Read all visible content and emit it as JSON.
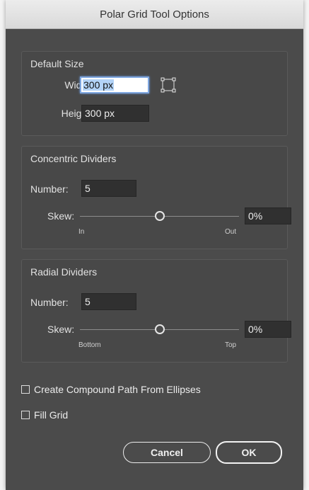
{
  "window": {
    "title": "Polar Grid Tool Options"
  },
  "default_size": {
    "title": "Default Size",
    "width_label": "Width:",
    "width_value": "300 px",
    "height_label": "Height:",
    "height_value": "300 px",
    "size_icon": "bounding-box-icon"
  },
  "concentric": {
    "title": "Concentric Dividers",
    "number_label": "Number:",
    "number_value": "5",
    "skew_label": "Skew:",
    "skew_value": "0%",
    "skew_slider": 0.5,
    "min_label": "In",
    "max_label": "Out"
  },
  "radial": {
    "title": "Radial Dividers",
    "number_label": "Number:",
    "number_value": "5",
    "skew_label": "Skew:",
    "skew_value": "0%",
    "skew_slider": 0.5,
    "min_label": "Bottom",
    "max_label": "Top"
  },
  "options": {
    "compound_label": "Create Compound Path From Ellipses",
    "compound_checked": false,
    "fill_label": "Fill Grid",
    "fill_checked": false
  },
  "buttons": {
    "cancel": "Cancel",
    "ok": "OK"
  },
  "colors": {
    "dialog_bg": "#4b4b4b",
    "field_bg": "#303030",
    "focus_ring": "#7fa7e0",
    "selection": "#b3d3f7"
  }
}
